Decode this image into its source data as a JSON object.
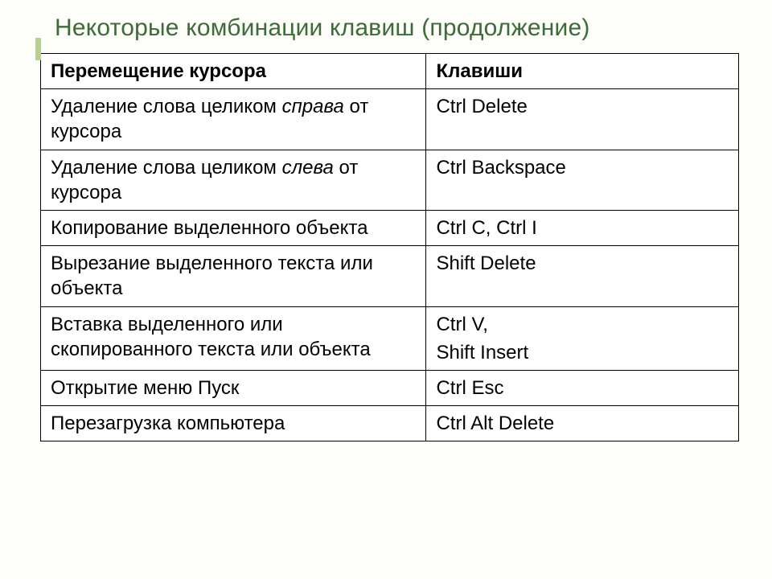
{
  "title": "Некоторые комбинации клавиш (продолжение)",
  "header": {
    "action": "Перемещение курсора",
    "keys": "Клавиши"
  },
  "rows": [
    {
      "action_prefix": "Удаление слова целиком ",
      "action_italic": "справа",
      "action_suffix": " от курсора",
      "keys": "Ctrl   Delete"
    },
    {
      "action_prefix": "Удаление слова целиком ",
      "action_italic": "слева",
      "action_suffix": " от курсора",
      "keys": "Ctrl   Backspace"
    },
    {
      "action_prefix": "Копирование выделенного объекта",
      "action_italic": "",
      "action_suffix": "",
      "keys": "Ctrl  C,    Ctrl  I"
    },
    {
      "action_prefix": "Вырезание выделенного текста или объекта",
      "action_italic": "",
      "action_suffix": "",
      "keys": "Shift  Delete"
    },
    {
      "action_prefix": "Вставка выделенного или скопированного текста или объекта",
      "action_italic": "",
      "action_suffix": "",
      "keys": "Ctrl  V,",
      "keys_line2": "Shift  Insert"
    },
    {
      "action_prefix": "Открытие меню Пуск",
      "action_italic": "",
      "action_suffix": "",
      "keys": "Ctrl  Esc"
    },
    {
      "action_prefix": "Перезагрузка компьютера",
      "action_italic": "",
      "action_suffix": "",
      "keys": "Ctrl Alt Delete"
    }
  ]
}
